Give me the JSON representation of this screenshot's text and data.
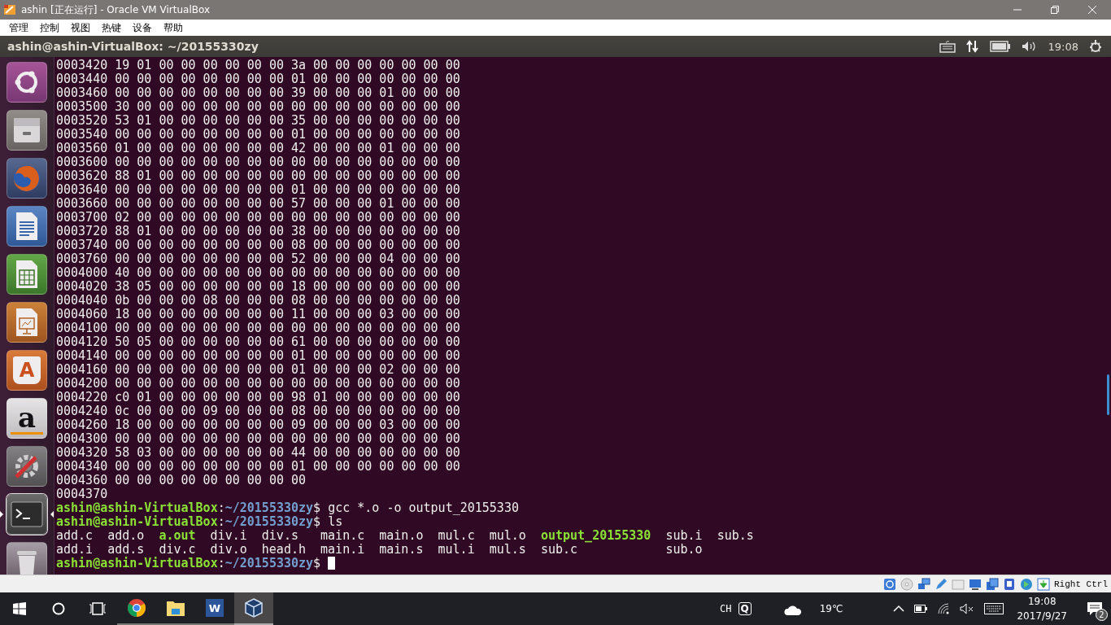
{
  "window": {
    "title": "ashin [正在运行] - Oracle VM VirtualBox"
  },
  "menu": [
    "管理",
    "控制",
    "视图",
    "热键",
    "设备",
    "帮助"
  ],
  "ubuntu_panel": {
    "title": "ashin@ashin-VirtualBox: ~/20155330zy",
    "clock": "19:08"
  },
  "launcher": [
    {
      "kind": "dash",
      "selected": false
    },
    {
      "kind": "files",
      "selected": false
    },
    {
      "kind": "firefox",
      "selected": false
    },
    {
      "kind": "writer",
      "selected": false
    },
    {
      "kind": "calc",
      "selected": false
    },
    {
      "kind": "impress",
      "selected": false
    },
    {
      "kind": "software",
      "label": "A",
      "selected": false
    },
    {
      "kind": "amazon",
      "label": "a",
      "selected": false
    },
    {
      "kind": "settings",
      "selected": false
    },
    {
      "kind": "terminal",
      "selected": true
    },
    {
      "kind": "trash",
      "selected": false
    }
  ],
  "terminal": {
    "lines": [
      {
        "kind": "text",
        "text": "0003420 19 01 00 00 00 00 00 00 3a 00 00 00 00 00 00 00"
      },
      {
        "kind": "text",
        "text": "0003440 00 00 00 00 00 00 00 00 01 00 00 00 00 00 00 00"
      },
      {
        "kind": "text",
        "text": "0003460 00 00 00 00 00 00 00 00 39 00 00 00 01 00 00 00"
      },
      {
        "kind": "text",
        "text": "0003500 30 00 00 00 00 00 00 00 00 00 00 00 00 00 00 00"
      },
      {
        "kind": "text",
        "text": "0003520 53 01 00 00 00 00 00 00 35 00 00 00 00 00 00 00"
      },
      {
        "kind": "text",
        "text": "0003540 00 00 00 00 00 00 00 00 01 00 00 00 00 00 00 00"
      },
      {
        "kind": "text",
        "text": "0003560 01 00 00 00 00 00 00 00 42 00 00 00 01 00 00 00"
      },
      {
        "kind": "text",
        "text": "0003600 00 00 00 00 00 00 00 00 00 00 00 00 00 00 00 00"
      },
      {
        "kind": "text",
        "text": "0003620 88 01 00 00 00 00 00 00 00 00 00 00 00 00 00 00"
      },
      {
        "kind": "text",
        "text": "0003640 00 00 00 00 00 00 00 00 01 00 00 00 00 00 00 00"
      },
      {
        "kind": "text",
        "text": "0003660 00 00 00 00 00 00 00 00 57 00 00 00 01 00 00 00"
      },
      {
        "kind": "text",
        "text": "0003700 02 00 00 00 00 00 00 00 00 00 00 00 00 00 00 00"
      },
      {
        "kind": "text",
        "text": "0003720 88 01 00 00 00 00 00 00 38 00 00 00 00 00 00 00"
      },
      {
        "kind": "text",
        "text": "0003740 00 00 00 00 00 00 00 00 08 00 00 00 00 00 00 00"
      },
      {
        "kind": "text",
        "text": "0003760 00 00 00 00 00 00 00 00 52 00 00 00 04 00 00 00"
      },
      {
        "kind": "text",
        "text": "0004000 40 00 00 00 00 00 00 00 00 00 00 00 00 00 00 00"
      },
      {
        "kind": "text",
        "text": "0004020 38 05 00 00 00 00 00 00 18 00 00 00 00 00 00 00"
      },
      {
        "kind": "text",
        "text": "0004040 0b 00 00 00 08 00 00 00 08 00 00 00 00 00 00 00"
      },
      {
        "kind": "text",
        "text": "0004060 18 00 00 00 00 00 00 00 11 00 00 00 03 00 00 00"
      },
      {
        "kind": "text",
        "text": "0004100 00 00 00 00 00 00 00 00 00 00 00 00 00 00 00 00"
      },
      {
        "kind": "text",
        "text": "0004120 50 05 00 00 00 00 00 00 61 00 00 00 00 00 00 00"
      },
      {
        "kind": "text",
        "text": "0004140 00 00 00 00 00 00 00 00 01 00 00 00 00 00 00 00"
      },
      {
        "kind": "text",
        "text": "0004160 00 00 00 00 00 00 00 00 01 00 00 00 02 00 00 00"
      },
      {
        "kind": "text",
        "text": "0004200 00 00 00 00 00 00 00 00 00 00 00 00 00 00 00 00"
      },
      {
        "kind": "text",
        "text": "0004220 c0 01 00 00 00 00 00 00 98 01 00 00 00 00 00 00"
      },
      {
        "kind": "text",
        "text": "0004240 0c 00 00 00 09 00 00 00 08 00 00 00 00 00 00 00"
      },
      {
        "kind": "text",
        "text": "0004260 18 00 00 00 00 00 00 00 09 00 00 00 03 00 00 00"
      },
      {
        "kind": "text",
        "text": "0004300 00 00 00 00 00 00 00 00 00 00 00 00 00 00 00 00"
      },
      {
        "kind": "text",
        "text": "0004320 58 03 00 00 00 00 00 00 44 00 00 00 00 00 00 00"
      },
      {
        "kind": "text",
        "text": "0004340 00 00 00 00 00 00 00 00 01 00 00 00 00 00 00 00"
      },
      {
        "kind": "text",
        "text": "0004360 00 00 00 00 00 00 00 00 00"
      },
      {
        "kind": "text",
        "text": "0004370"
      },
      {
        "kind": "prompt",
        "user": "ashin@ashin-VirtualBox",
        "sep": ":",
        "path": "~/20155330zy",
        "command": "$ gcc *.o -o output_20155330",
        "cursor": false
      },
      {
        "kind": "prompt",
        "user": "ashin@ashin-VirtualBox",
        "sep": ":",
        "path": "~/20155330zy",
        "command": "$ ls",
        "cursor": false
      },
      {
        "kind": "ls",
        "columns": [
          [
            {
              "name": "add.c",
              "executable": false
            },
            {
              "name": "add.i",
              "executable": false
            }
          ],
          [
            {
              "name": "add.o",
              "executable": false
            },
            {
              "name": "add.s",
              "executable": false
            }
          ],
          [
            {
              "name": "a.out",
              "executable": true
            },
            {
              "name": "div.c",
              "executable": false
            }
          ],
          [
            {
              "name": "div.i",
              "executable": false
            },
            {
              "name": "div.o",
              "executable": false
            }
          ],
          [
            {
              "name": "div.s",
              "executable": false
            },
            {
              "name": "head.h",
              "executable": false
            }
          ],
          [
            {
              "name": "main.c",
              "executable": false
            },
            {
              "name": "main.i",
              "executable": false
            }
          ],
          [
            {
              "name": "main.o",
              "executable": false
            },
            {
              "name": "main.s",
              "executable": false
            }
          ],
          [
            {
              "name": "mul.c",
              "executable": false
            },
            {
              "name": "mul.i",
              "executable": false
            }
          ],
          [
            {
              "name": "mul.o",
              "executable": false
            },
            {
              "name": "mul.s",
              "executable": false
            }
          ],
          [
            {
              "name": "output_20155330",
              "executable": true
            },
            {
              "name": "sub.c",
              "executable": false
            }
          ],
          [
            {
              "name": "sub.i",
              "executable": false
            },
            {
              "name": "sub.o",
              "executable": false
            }
          ],
          [
            {
              "name": "sub.s",
              "executable": false
            }
          ]
        ]
      },
      {
        "kind": "prompt",
        "user": "ashin@ashin-VirtualBox",
        "sep": ":",
        "path": "~/20155330zy",
        "command": "$",
        "cursor": true
      }
    ]
  },
  "vbox_status": {
    "host_key": "Right Ctrl"
  },
  "taskbar": {
    "apps": [
      {
        "kind": "chrome",
        "running": true,
        "selected": false
      },
      {
        "kind": "explorer",
        "running": true,
        "selected": false
      },
      {
        "kind": "word",
        "label": "W",
        "running": true,
        "selected": false
      },
      {
        "kind": "virtualbox",
        "running": true,
        "selected": true
      }
    ],
    "ime": "CH",
    "ime_mode": "Q",
    "temperature": "19℃",
    "time": "19:08",
    "date": "2017/9/27",
    "notifications": "2"
  }
}
